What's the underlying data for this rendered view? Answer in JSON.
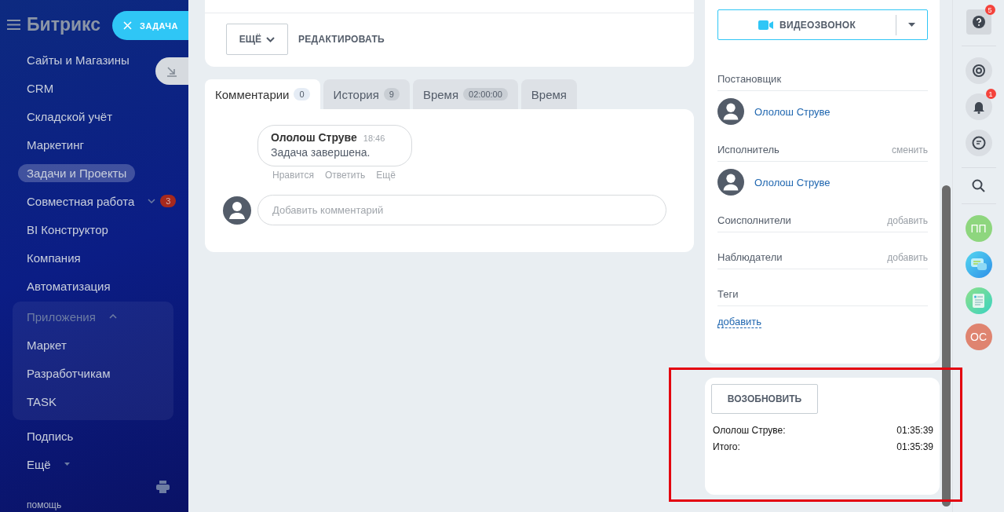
{
  "sidebar": {
    "logo": "Битрикс",
    "items": [
      {
        "label": "Сайты и Магазины",
        "selected": false
      },
      {
        "label": "CRM",
        "selected": false
      },
      {
        "label": "Складской учёт",
        "selected": false
      },
      {
        "label": "Маркетинг",
        "selected": false
      },
      {
        "label": "Задачи и Проекты",
        "selected": true
      },
      {
        "label": "Совместная работа",
        "selected": false,
        "expandable": true,
        "badge": "3"
      },
      {
        "label": "BI Конструктор",
        "selected": false
      },
      {
        "label": "Компания",
        "selected": false
      },
      {
        "label": "Автоматизация",
        "selected": false
      }
    ],
    "apps_group": {
      "label": "Приложения",
      "expanded": true,
      "items": [
        {
          "label": "Маркет"
        },
        {
          "label": "Разработчикам"
        },
        {
          "label": "TASK"
        }
      ]
    },
    "items_after": [
      {
        "label": "Подпись",
        "dropdown": false
      },
      {
        "label": "Ещё",
        "dropdown": true
      }
    ],
    "help": "помощь"
  },
  "task_button": {
    "label": "ЗАДАЧА"
  },
  "actions": {
    "more": "ЕЩЁ",
    "edit": "РЕДАКТИРОВАТЬ"
  },
  "tabs": [
    {
      "label": "Комментарии",
      "count": "0",
      "selected": true
    },
    {
      "label": "История",
      "count": "9",
      "selected": false
    },
    {
      "label": "Время",
      "count": "02:00:00",
      "selected": false
    },
    {
      "label": "Время",
      "selected": false
    }
  ],
  "comment": {
    "author": "Ололош Струве",
    "time": "18:46",
    "text": "Задача завершена.",
    "actions": [
      "Нравится",
      "Ответить",
      "Ещё"
    ]
  },
  "comment_input": {
    "placeholder": "Добавить комментарий"
  },
  "side_panel": {
    "video_call": "ВИДЕОЗВОНОК",
    "sections": [
      {
        "title": "Постановщик",
        "person": "Ололош Струве"
      },
      {
        "title": "Исполнитель",
        "action": "сменить",
        "person": "Ололош Струве"
      },
      {
        "title": "Соисполнители",
        "action": "добавить"
      },
      {
        "title": "Наблюдатели",
        "action": "добавить"
      },
      {
        "title": "Теги",
        "link": "добавить"
      }
    ]
  },
  "time_panel": {
    "button": "ВОЗОБНОВИТЬ",
    "highlighted": true,
    "rows": [
      {
        "label": "Ололош Струве:",
        "value": "01:35:39"
      },
      {
        "label": "Итого:",
        "value": "01:35:39"
      }
    ]
  },
  "right_bar": {
    "help_badge": "5",
    "notifications_badge": "1",
    "avatars": [
      {
        "kind": "initials",
        "initials": "ПП",
        "color": "#8ed67e"
      },
      {
        "kind": "chat"
      },
      {
        "kind": "news"
      },
      {
        "kind": "initials",
        "initials": "ОС",
        "color": "#df8470"
      }
    ]
  }
}
